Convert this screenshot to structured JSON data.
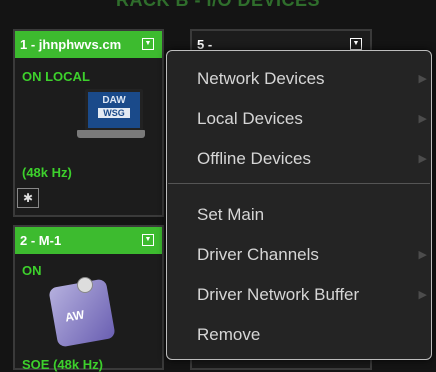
{
  "rack_title": "RACK B - I/O DEVICES",
  "slots": [
    {
      "header": "1 - jhnphwvs.cm",
      "status": "ON  LOCAL",
      "rate": "(48k Hz)",
      "image": {
        "line1": "DAW",
        "line2": "WSG"
      }
    },
    {
      "header": "2 - M-1",
      "status": "ON",
      "rate": "SOE (48k Hz)",
      "image": {
        "label": "AW"
      }
    },
    {
      "header": "5 -"
    },
    {
      "header": ""
    }
  ],
  "menu": {
    "items": [
      {
        "label": "Network Devices",
        "submenu": true
      },
      {
        "label": "Local Devices",
        "submenu": true
      },
      {
        "label": "Offline Devices",
        "submenu": true
      },
      {
        "label": "Set Main",
        "submenu": false
      },
      {
        "label": "Driver Channels",
        "submenu": true
      },
      {
        "label": "Driver Network Buffer",
        "submenu": true
      },
      {
        "label": "Remove",
        "submenu": false
      }
    ]
  },
  "icons": {
    "menu_toggle": "dropdown-square-icon",
    "gear": "gear-icon",
    "submenu": "chevron-right-icon"
  },
  "colors": {
    "header_green": "#3dbb2f",
    "status_green": "#3dd02c",
    "menu_bg": "#242424"
  }
}
